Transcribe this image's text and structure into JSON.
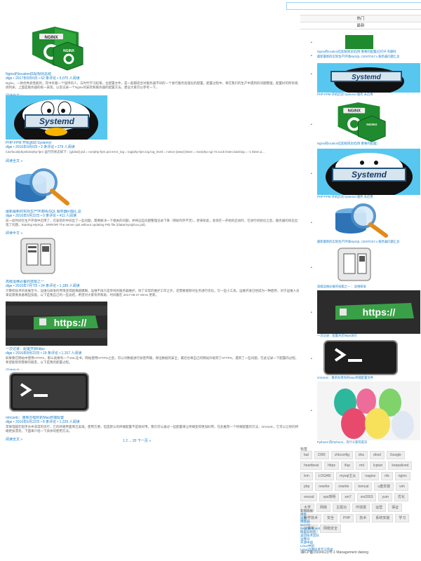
{
  "sidebar": {
    "tabs": [
      {
        "label": "热门"
      },
      {
        "label": "最新"
      }
    ],
    "items": [
      {
        "title": "Nginx的location匹配规则总结(附:重要的配置)已打开 有删除"
      },
      {
        "title": "最新最新的实际生产环境MySQL CENTOS7.x 服务器问题汇总"
      },
      {
        "title": "PHP-FPM 开机启动 Systemd 服务 未启用"
      },
      {
        "title": "Nginx的location匹配规则总结(附:重要的配置)"
      },
      {
        "title": "PHP-FPM 开机启动 Systemd 服务 未启用"
      },
      {
        "title": "最新最新的实际生产环境MySQL CENTOS7.x 服务器问题汇总"
      },
      {
        "title": "高级运维必备的技能之一 ：运维研发"
      },
      {
        "title": "一次记录：配置开启https访问"
      },
      {
        "title": "nmcsetc：重新办理你的Mac终端配置文件"
      },
      {
        "title": "Python3 的Python2，有什么新的差异"
      }
    ]
  },
  "tag_title": "标签",
  "tags": [
    "bat",
    "DDR",
    "chkconfig",
    "dns",
    "dnsd",
    "Google",
    "heartbeat",
    "https",
    "ifup",
    "md",
    "lcptun",
    "keepalived",
    "lvm",
    "LOGAN",
    "mysql主从",
    "nagios",
    "nfs",
    "nginx",
    "php",
    "rewrite",
    "rewrite",
    "tomcat",
    "u盘安装",
    "vim",
    "vmcsd",
    "vps简明",
    "xm7",
    "xm2003",
    "yum",
    "优化",
    "大学",
    "网络",
    "主题功",
    "环境搭",
    "运营",
    "保证",
    "科学技术",
    "安全",
    "PHP",
    "技术",
    "系统安装",
    "学习",
    "计算机",
    "网络安全"
  ],
  "links": [
    "友情链接",
    "博客",
    "运维",
    "博客园",
    "51CTO",
    "SegmentFault",
    "阿里云社区",
    "美团技术团队",
    "运维派",
    "开源中国",
    "Linux中国",
    "Linux运维技术学习平台"
  ],
  "footer": "湘ICP备15034123号-1  Management dalong",
  "posts": [
    {
      "title": "Nginx的location匹配规则总结",
      "meta": "dlge  •  2017年8月6日  •  62 条评论  •  5,075 人阅读",
      "excerpt": "Nginx，一款优秀高性能的，其中有着一个强悍的人，与时代学习起来，主配置文件，是一般都适合对服务器不同的一个进行服务处理化的配置，配置过程中，将在我们的生产中遇到的问题整理，配置好的所有规则列表，上面是服务器的统一安装，以及记录一个Nginx的安装和服务器的配置方法，建议大家可以参考一下。",
      "more": "阅读全文 »",
      "art": "nginx"
    },
    {
      "title": "PHP-FPM 开机启动 Systemd",
      "meta": "dlge  •  2016年9月6日  •  2 条评论  •  279 人阅读",
      "excerpt": "/usr/local/php/sbin/php-fpm 运行的状态如下：[global] pid = run/php-fpm.pid error_log = log/php-fpm.log log_level = notice [www] listen = /var/php-cgi-72.sock listen.backlog = -1 listen.a...",
      "more": "阅读全文 »",
      "art": "systemd"
    },
    {
      "title": "最新最新的实际生产环境MySQL 服务器问题汇总",
      "meta": "dlge  •  2016年6月22日  •  0 条评论  •  411 人阅读",
      "excerpt": "前一段时间在生产环境中启用了，在安装的中间出了一些问题，需要解决一下相关的问题，并将这些问题整理记录下来（例如内存不足）。原来如此，发现在一开始的启动时，在进行初始化之后，服务器的状态出现了问题，Starting MySQL . ERROR! The server quit without updating PID file (/data/mysql/xxx.pid).",
      "more": "阅读全文 »",
      "art": "mysql"
    },
    {
      "title": "高级运维必备的技能之一",
      "meta": "dlge  •  2016年7月7日  •  24 条评论  •  1,189 人阅读",
      "excerpt": "计算机技术的发展至今，运维与研发的界限变得越来越模糊，运维不再只是单纯的服务器维护，除了日常的维护工作之外，还需要能够对业务进行优化，写一些小工具，运维开发已经成为一种趋势，对于运维人员来说需要具备哪些技能，以下是我自己的一些总结，希望对大家有所帮助，时间戳在 2017-08-27 08:01 更新。",
      "more": "阅读全文 »",
      "art": "server"
    },
    {
      "title": "一次记录：配置开启https",
      "meta": "dlge  •  2016年8月22日  •  19 条评论  •  1,157 人阅读",
      "excerpt": "如果要在网站中使用HTTPS，那么就要有一个SSL证书，网站使用HTTPS之后，可以对数据进行加密传输，保证数据的安全，最近也将自己的网站升级到了HTTPS，遇到了一些问题，在此记录一下配置的过程，希望能帮到需要的朋友，以下是我的配置过程。",
      "more": "阅读全文 »",
      "art": "https"
    },
    {
      "title": "nmcsetc：重新办理你的Mac终端配置",
      "meta": "dlge  •  2016年6月22日  •  8 条评论  •  1,229 人阅读",
      "excerpt": "苹果电脑在程序员中非常的流行，它的终端界面简洁美观，使用方便，但是默认的终端配置不是很好用，我们可以通过一些配置来让终端变得更加好用，在此推荐一个终端配置的方法，nmcsetc，它可以让你的终端更加漂亮，下面来介绍一下具体的使用方法。",
      "more": "阅读全文 »",
      "art": "terminal"
    }
  ],
  "pager": "1 2 ... 20 下一页 »"
}
